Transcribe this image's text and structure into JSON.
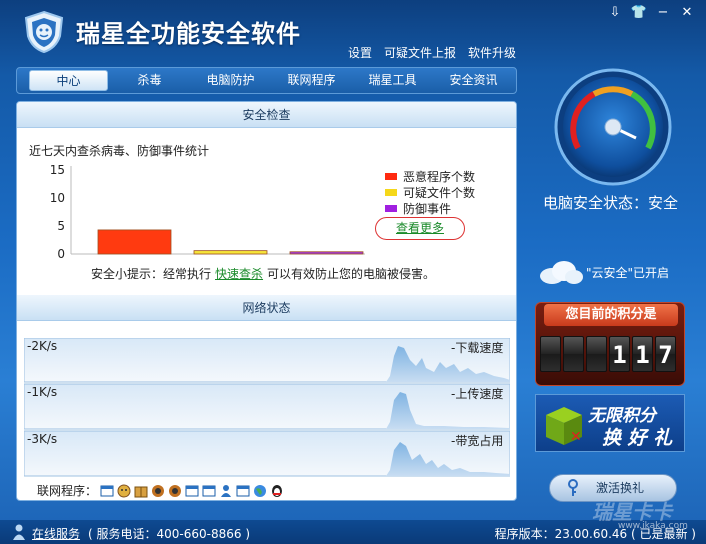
{
  "app": {
    "title": "瑞星全功能安全软件",
    "toplinks": [
      "设置",
      "可疑文件上报",
      "软件升级"
    ]
  },
  "nav": {
    "tabs": [
      "中心",
      "杀毒",
      "电脑防护",
      "联网程序",
      "瑞星工具",
      "安全资讯"
    ],
    "active": 0
  },
  "security_check": {
    "header": "安全检查",
    "stat_title": "近七天内查杀病毒、防御事件统计",
    "more_link": "查看更多",
    "tip_prefix": "安全小提示：经常执行",
    "tip_link": "快速查杀",
    "tip_suffix": "可以有效防止您的电脑被侵害。"
  },
  "chart_data": {
    "type": "bar",
    "categories": [
      "恶意程序个数",
      "可疑文件个数",
      "防御事件"
    ],
    "values": [
      4.3,
      0.6,
      0.4
    ],
    "colors": [
      "#ff3a10",
      "#f5e43a",
      "#a23ad6"
    ],
    "yticks": [
      0,
      5,
      10,
      15
    ],
    "ylim": [
      0,
      15
    ]
  },
  "network": {
    "header": "网络状态",
    "rows": [
      {
        "left": "-2K/s",
        "right": "-下载速度"
      },
      {
        "left": "-1K/s",
        "right": "-上传速度"
      },
      {
        "left": "-3K/s",
        "right": "-带宽占用"
      }
    ],
    "apps_label": "联网程序："
  },
  "right": {
    "status_text": "电脑安全状态：安全",
    "cloud_text": "\"云安全\"已开启",
    "score_title": "您目前的积分是",
    "score_digits": [
      "",
      "",
      "",
      "1",
      "1",
      "7"
    ],
    "promo_line1": "无限积分",
    "promo_line2": "换 好 礼",
    "activate_label": "激活换礼"
  },
  "bottom": {
    "service_link": "在线服务",
    "phone": "( 服务电话：400-660-8866 )",
    "version": "程序版本：23.00.60.46 ( 已是最新 )"
  },
  "watermark": {
    "text": "瑞星卡卡",
    "url": "www.ikaka.com"
  }
}
